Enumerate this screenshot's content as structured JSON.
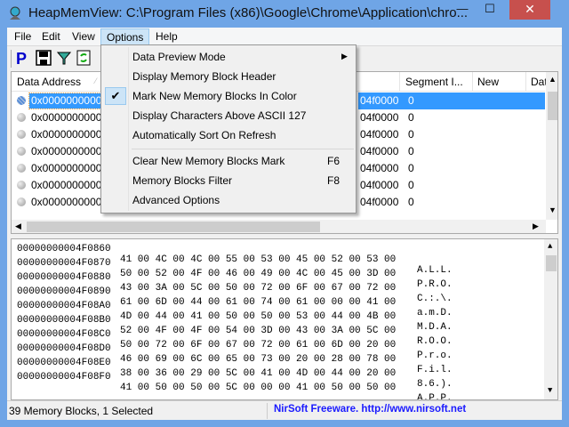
{
  "window": {
    "title": "HeapMemView:   C:\\Program Files (x86)\\Google\\Chrome\\Application\\chro...",
    "minimize": "—",
    "maximize": "☐",
    "close": "✕"
  },
  "menubar": [
    "File",
    "Edit",
    "View",
    "Options",
    "Help"
  ],
  "toolbar": [
    "properties-icon",
    "save-icon",
    "filter-icon",
    "refresh-icon"
  ],
  "list": {
    "headers": {
      "data_address": "Data Address",
      "segment": "Segment I...",
      "new": "New",
      "dat": "Dat"
    },
    "rows": [
      {
        "addr": "0x00000000004f",
        "a": "04f0000",
        "b": "0",
        "selected": true
      },
      {
        "addr": "0x00000000004f",
        "a": "04f0000",
        "b": "0"
      },
      {
        "addr": "0x00000000004f",
        "a": "04f0000",
        "b": "0"
      },
      {
        "addr": "0x00000000004f",
        "a": "04f0000",
        "b": "0"
      },
      {
        "addr": "0x00000000004f",
        "a": "04f0000",
        "b": "0"
      },
      {
        "addr": "0x00000000004f",
        "a": "04f0000",
        "b": "0"
      },
      {
        "addr": "0x00000000004f",
        "a": "04f0000",
        "b": "0"
      }
    ]
  },
  "options_menu": {
    "items": [
      {
        "label": "Data Preview Mode",
        "submenu": true
      },
      {
        "label": "Display Memory Block Header"
      },
      {
        "label": "Mark New Memory Blocks In Color",
        "checked": true
      },
      {
        "label": "Display Characters Above ASCII 127"
      },
      {
        "label": "Automatically Sort On Refresh"
      },
      {
        "label": "Clear New Memory Blocks Mark",
        "shortcut": "F6"
      },
      {
        "label": "Memory Blocks Filter",
        "shortcut": "F8"
      },
      {
        "label": "Advanced Options"
      }
    ],
    "arrow": "▶",
    "check": "✔"
  },
  "hex": [
    {
      "off": "00000000004F0860",
      "bytes": "41 00 4C 00 4C 00 55 00 53 00 45 00 52 00 53 00",
      "ascii": "A.L.L."
    },
    {
      "off": "00000000004F0870",
      "bytes": "50 00 52 00 4F 00 46 00 49 00 4C 00 45 00 3D 00",
      "ascii": "P.R.O."
    },
    {
      "off": "00000000004F0880",
      "bytes": "43 00 3A 00 5C 00 50 00 72 00 6F 00 67 00 72 00",
      "ascii": "C.:.\\."
    },
    {
      "off": "00000000004F0890",
      "bytes": "61 00 6D 00 44 00 61 00 74 00 61 00 00 00 41 00",
      "ascii": "a.m.D."
    },
    {
      "off": "00000000004F08A0",
      "bytes": "4D 00 44 00 41 00 50 00 50 00 53 00 44 00 4B 00",
      "ascii": "M.D.A."
    },
    {
      "off": "00000000004F08B0",
      "bytes": "52 00 4F 00 4F 00 54 00 3D 00 43 00 3A 00 5C 00",
      "ascii": "R.O.O."
    },
    {
      "off": "00000000004F08C0",
      "bytes": "50 00 72 00 6F 00 67 00 72 00 61 00 6D 00 20 00",
      "ascii": "P.r.o."
    },
    {
      "off": "00000000004F08D0",
      "bytes": "46 00 69 00 6C 00 65 00 73 00 20 00 28 00 78 00",
      "ascii": "F.i.l."
    },
    {
      "off": "00000000004F08E0",
      "bytes": "38 00 36 00 29 00 5C 00 41 00 4D 00 44 00 20 00",
      "ascii": "8.6.)."
    },
    {
      "off": "00000000004F08F0",
      "bytes": "41 00 50 00 50 00 5C 00 00 00 41 00 50 00 50 00",
      "ascii": "A.P.P."
    }
  ],
  "status": {
    "left": "39 Memory Blocks, 1 Selected",
    "right": "NirSoft Freeware.  http://www.nirsoft.net"
  }
}
